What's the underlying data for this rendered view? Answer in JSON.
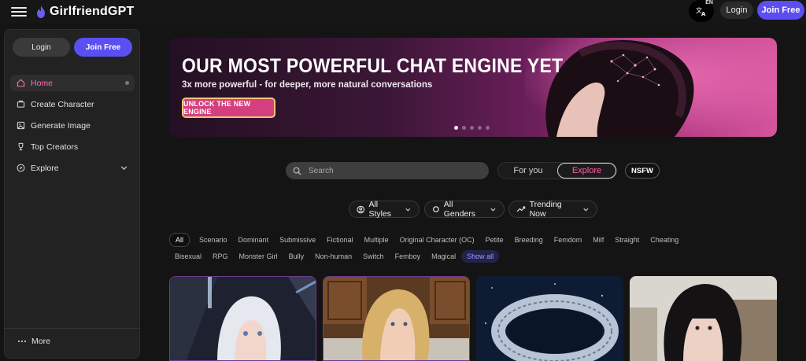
{
  "header": {
    "brand": "GirlfriendGPT",
    "language_code": "EN",
    "login_label": "Login",
    "join_label": "Join Free"
  },
  "sidebar": {
    "login_label": "Login",
    "join_label": "Join Free",
    "items": [
      {
        "label": "Home",
        "icon": "home-icon",
        "active": true
      },
      {
        "label": "Create Character",
        "icon": "create-icon"
      },
      {
        "label": "Generate Image",
        "icon": "image-icon"
      },
      {
        "label": "Top Creators",
        "icon": "trophy-icon"
      },
      {
        "label": "Explore",
        "icon": "compass-icon"
      }
    ],
    "more_label": "More"
  },
  "banner": {
    "title": "OUR MOST POWERFUL CHAT ENGINE YET",
    "subtitle": "3x more powerful - for deeper, more natural conversations",
    "cta": "UNLOCK THE NEW ENGINE",
    "slide_count": 5,
    "active_slide": 1
  },
  "search": {
    "placeholder": "Search"
  },
  "view_toggle": {
    "for_you": "For you",
    "explore": "Explore",
    "selected": "Explore"
  },
  "nsfw_label": "NSFW",
  "filters": {
    "styles": "All Styles",
    "genders": "All Genders",
    "sort": "Trending Now"
  },
  "tags": {
    "row1": [
      "All",
      "Scenario",
      "Dominant",
      "Submissive",
      "Fictional",
      "Multiple",
      "Original Character (OC)",
      "Petite",
      "Breeding",
      "Femdom",
      "Milf",
      "Straight",
      "Cheating"
    ],
    "row2": [
      "Bisexual",
      "RPG",
      "Monster Girl",
      "Bully",
      "Non-human",
      "Switch",
      "Femboy",
      "Magical"
    ],
    "show_all": "Show all",
    "selected": "All"
  },
  "colors": {
    "accent": "#5b4ef2",
    "pink": "#ff5fa8",
    "background": "#141414",
    "sidebar": "#222222"
  }
}
